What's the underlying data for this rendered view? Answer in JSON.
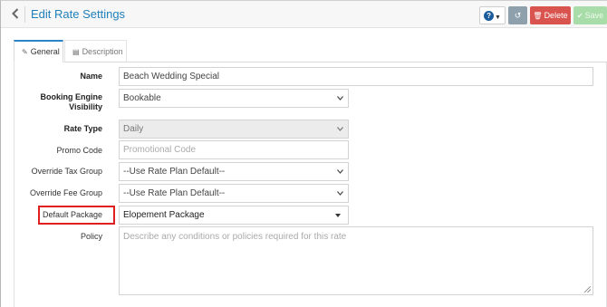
{
  "header": {
    "title": "Edit Rate Settings",
    "help_label": "?",
    "delete_label": "Delete",
    "save_label": "Save"
  },
  "tabs": [
    {
      "label": "General",
      "active": true
    },
    {
      "label": "Description",
      "active": false
    }
  ],
  "form": {
    "name": {
      "label": "Name",
      "value": "Beach Wedding Special"
    },
    "booking_engine_visibility": {
      "label_line1": "Booking Engine",
      "label_line2": "Visibility",
      "value": "Bookable"
    },
    "rate_type": {
      "label": "Rate Type",
      "value": "Daily"
    },
    "promo_code": {
      "label": "Promo Code",
      "placeholder": "Promotional Code"
    },
    "override_tax_group": {
      "label": "Override Tax Group",
      "value": "--Use Rate Plan Default--"
    },
    "override_fee_group": {
      "label": "Override Fee Group",
      "value": "--Use Rate Plan Default--"
    },
    "default_package": {
      "label": "Default Package",
      "value": "Elopement Package"
    },
    "policy": {
      "label": "Policy",
      "placeholder": "Describe any conditions or policies required for this rate"
    }
  },
  "colors": {
    "title": "#1f7fb8",
    "delete": "#d9534f",
    "save": "#a8dca8",
    "highlight": "#e02020"
  }
}
